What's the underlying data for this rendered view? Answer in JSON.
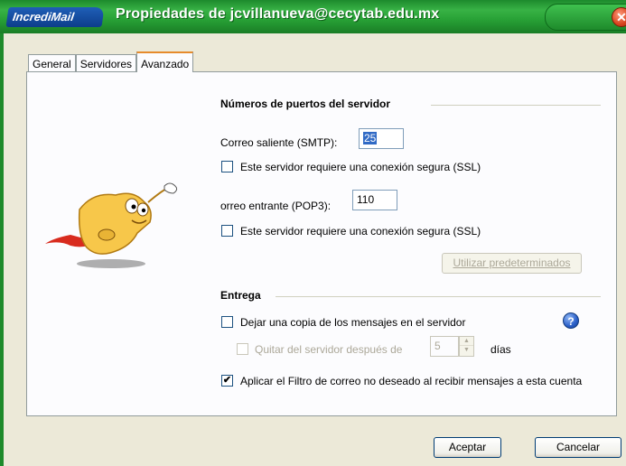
{
  "window": {
    "brand": "IncrediMail",
    "title": "Propiedades de jcvillanueva@cecytab.edu.mx",
    "close_glyph": "✕"
  },
  "tabs": [
    {
      "label": "General",
      "active": false
    },
    {
      "label": "Servidores",
      "active": false
    },
    {
      "label": "Avanzado",
      "active": true
    }
  ],
  "ports": {
    "heading": "Números de puertos del servidor",
    "smtp_label": "Correo saliente (SMTP):",
    "smtp_value": "25",
    "smtp_ssl_label": "Este servidor requiere una conexión segura (SSL)",
    "smtp_ssl_checked": false,
    "pop3_label": "orreo entrante (POP3):",
    "pop3_value": "110",
    "pop3_ssl_label": "Este servidor requiere una conexión segura (SSL)",
    "pop3_ssl_checked": false,
    "defaults_button": "Utilizar predeterminados"
  },
  "delivery": {
    "heading": "Entrega",
    "keep_copy_label": "Dejar una copia de los mensajes en el servidor",
    "keep_copy_checked": false,
    "remove_after_label": "Quitar del servidor después de",
    "remove_after_value": "5",
    "days_label": "días",
    "junk_filter_label": "Aplicar el Filtro de correo no deseado al recibir mensajes a esta cuenta",
    "junk_filter_checked": true,
    "help_glyph": "?"
  },
  "footer": {
    "ok_button": "Aceptar",
    "cancel_button": "Cancelar"
  },
  "icons": {
    "mascot": "incredimail-flying-envelope-mascot",
    "help": "help-icon",
    "close": "close-icon"
  },
  "colors": {
    "titlebar": "#27a035",
    "brand": "#1f5fb8",
    "selection": "#316ac5",
    "tab_highlight": "#e68b2c"
  }
}
